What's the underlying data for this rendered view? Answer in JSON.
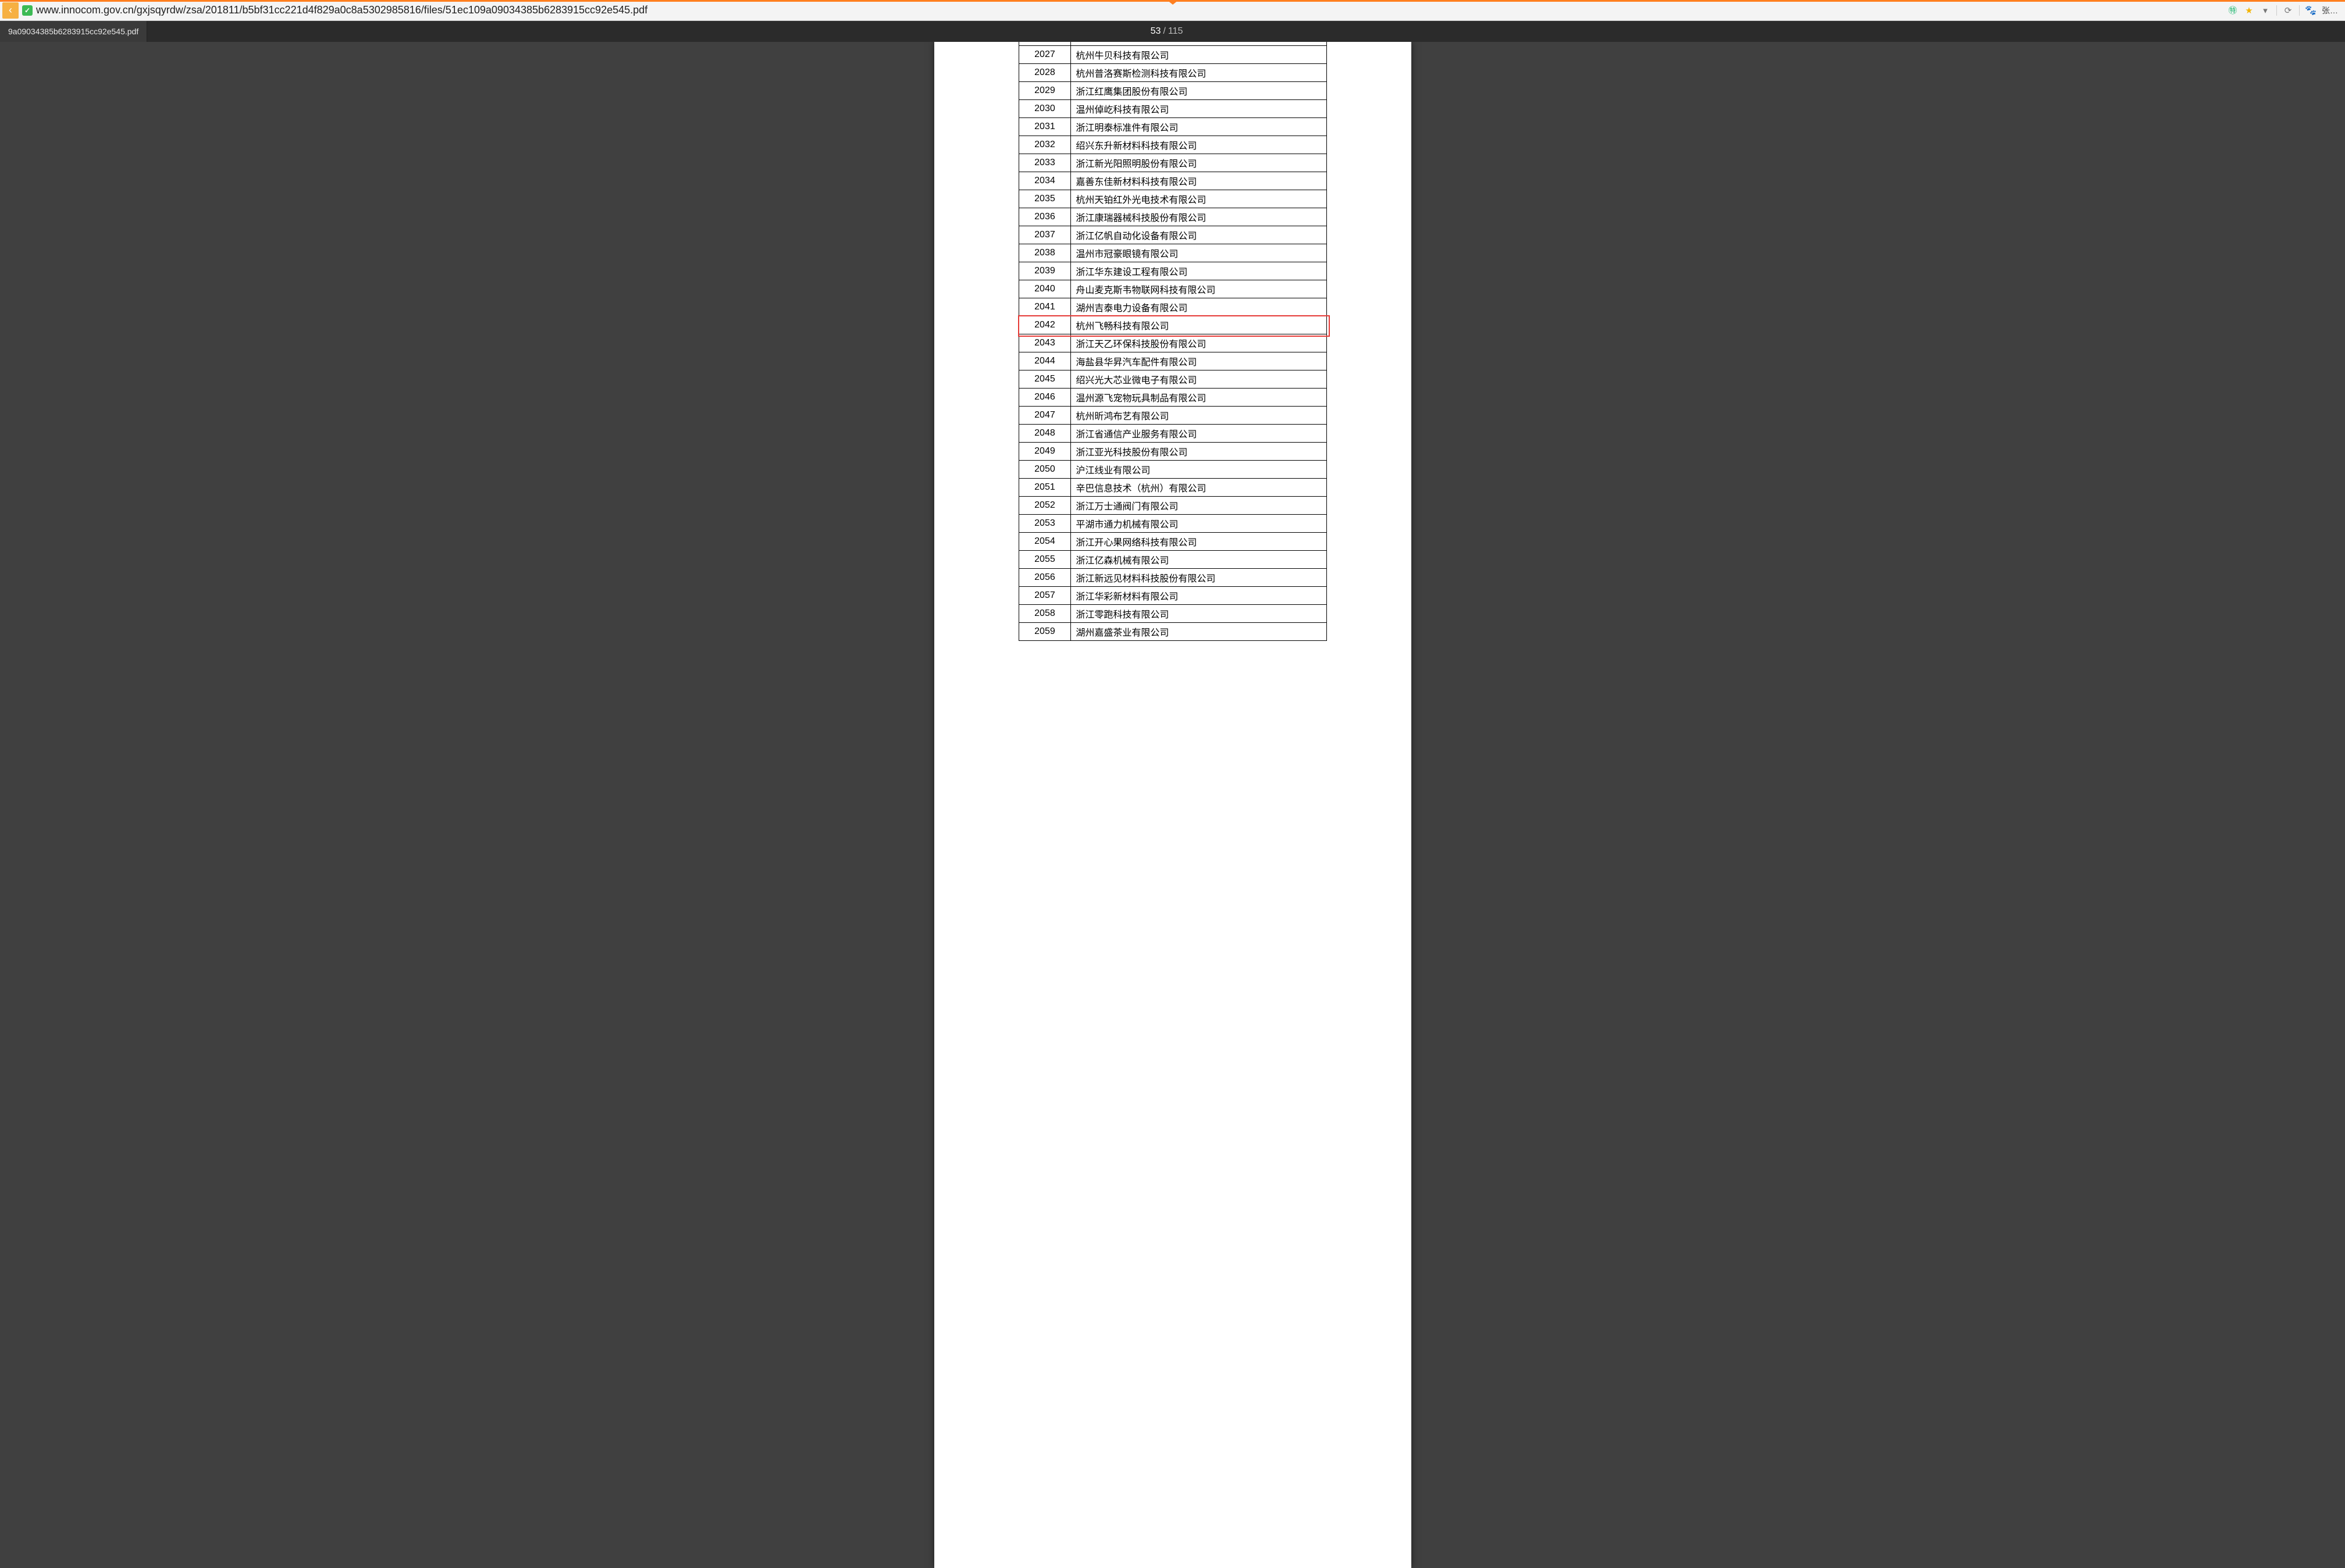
{
  "browser": {
    "url": "www.innocom.gov.cn/gxjsqyrdw/zsa/201811/b5bf31cc221d4f829a0c8a5302985816/files/51ec109a09034385b6283915cc92e545.pdf",
    "tab_label": "9a09034385b6283915cc92e545.pdf",
    "user_label": "张…"
  },
  "pdf_viewer": {
    "current_page": "53",
    "total_pages": "115"
  },
  "table": {
    "highlight_index": "2042",
    "rows": [
      {
        "index": "2027",
        "name": "杭州牛贝科技有限公司"
      },
      {
        "index": "2028",
        "name": "杭州普洛赛斯检测科技有限公司"
      },
      {
        "index": "2029",
        "name": "浙江红鹰集团股份有限公司"
      },
      {
        "index": "2030",
        "name": "温州倬屹科技有限公司"
      },
      {
        "index": "2031",
        "name": "浙江明泰标准件有限公司"
      },
      {
        "index": "2032",
        "name": "绍兴东升新材料科技有限公司"
      },
      {
        "index": "2033",
        "name": "浙江新光阳照明股份有限公司"
      },
      {
        "index": "2034",
        "name": "嘉善东佳新材料科技有限公司"
      },
      {
        "index": "2035",
        "name": "杭州天铂红外光电技术有限公司"
      },
      {
        "index": "2036",
        "name": "浙江康瑞器械科技股份有限公司"
      },
      {
        "index": "2037",
        "name": "浙江亿帆自动化设备有限公司"
      },
      {
        "index": "2038",
        "name": "温州市冠豪眼镜有限公司"
      },
      {
        "index": "2039",
        "name": "浙江华东建设工程有限公司"
      },
      {
        "index": "2040",
        "name": "舟山麦克斯韦物联网科技有限公司"
      },
      {
        "index": "2041",
        "name": "湖州吉泰电力设备有限公司"
      },
      {
        "index": "2042",
        "name": "杭州飞畅科技有限公司"
      },
      {
        "index": "2043",
        "name": "浙江天乙环保科技股份有限公司"
      },
      {
        "index": "2044",
        "name": "海盐县华昇汽车配件有限公司"
      },
      {
        "index": "2045",
        "name": "绍兴光大芯业微电子有限公司"
      },
      {
        "index": "2046",
        "name": "温州源飞宠物玩具制品有限公司"
      },
      {
        "index": "2047",
        "name": "杭州昕鸿布艺有限公司"
      },
      {
        "index": "2048",
        "name": "浙江省通信产业服务有限公司"
      },
      {
        "index": "2049",
        "name": "浙江亚光科技股份有限公司"
      },
      {
        "index": "2050",
        "name": "沪江线业有限公司"
      },
      {
        "index": "2051",
        "name": "辛巴信息技术（杭州）有限公司"
      },
      {
        "index": "2052",
        "name": "浙江万士通阀门有限公司"
      },
      {
        "index": "2053",
        "name": "平湖市通力机械有限公司"
      },
      {
        "index": "2054",
        "name": "浙江开心果网络科技有限公司"
      },
      {
        "index": "2055",
        "name": "浙江亿森机械有限公司"
      },
      {
        "index": "2056",
        "name": "浙江新远见材料科技股份有限公司"
      },
      {
        "index": "2057",
        "name": "浙江华彩新材料有限公司"
      },
      {
        "index": "2058",
        "name": "浙江零跑科技有限公司"
      },
      {
        "index": "2059",
        "name": "湖州嘉盛茶业有限公司"
      }
    ]
  }
}
